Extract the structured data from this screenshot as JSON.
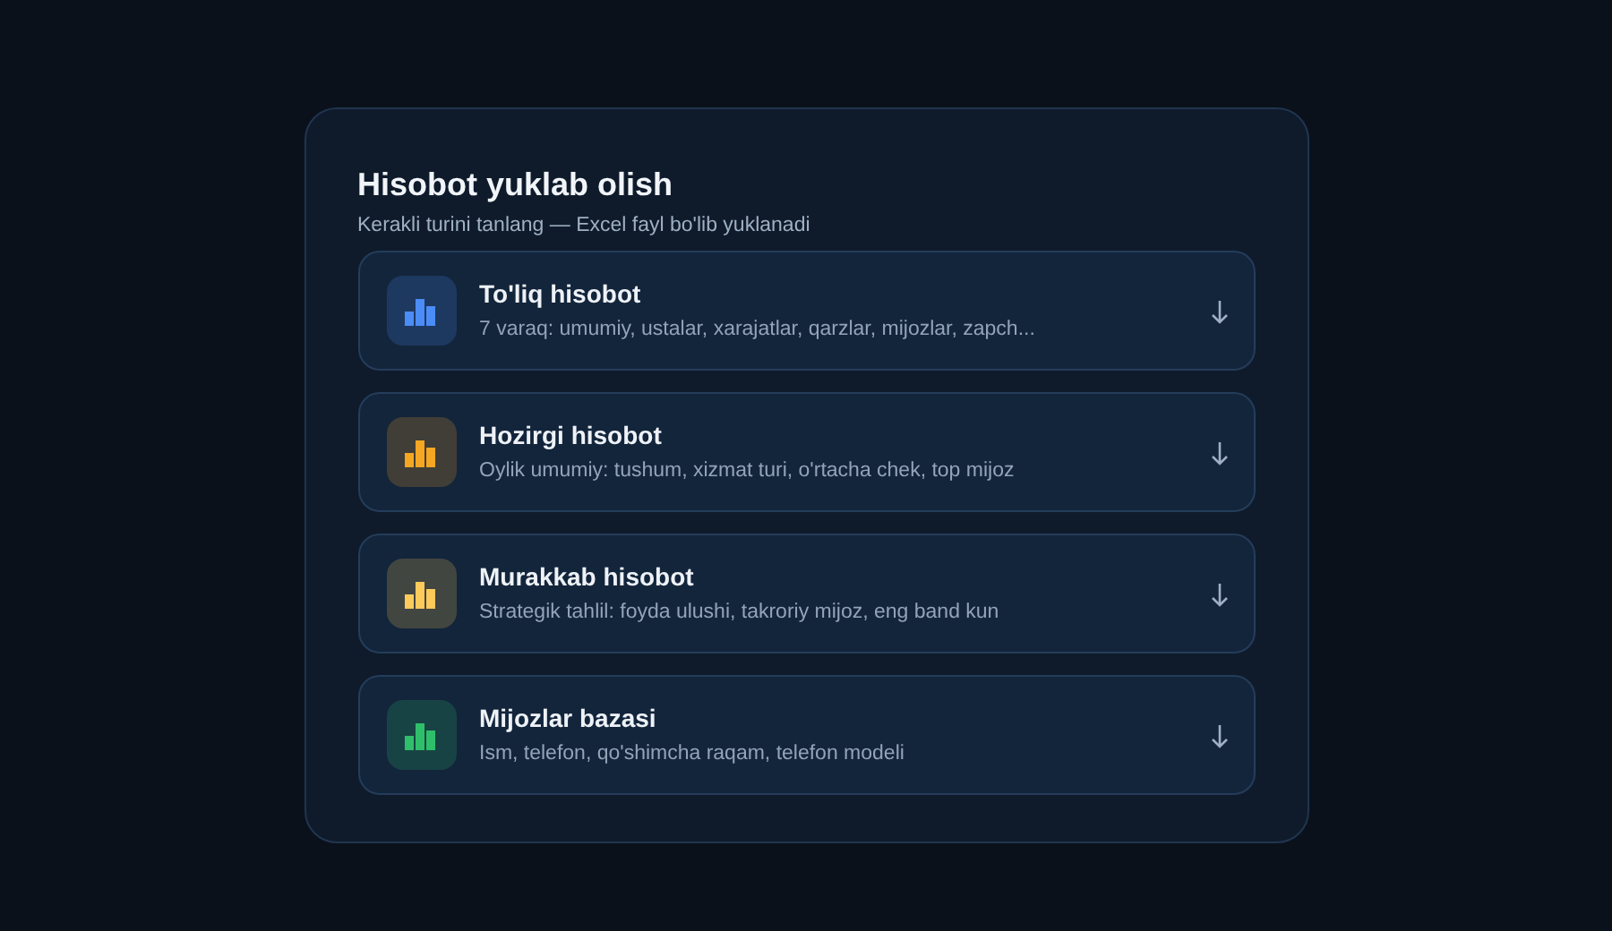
{
  "dialog": {
    "title": "Hisobot yuklab olish",
    "subtitle": "Kerakli turini tanlang — Excel fayl bo'lib yuklanadi",
    "options": [
      {
        "title": "To'liq hisobot",
        "description": "7 varaq: umumiy, ustalar, xarajatlar, qarzlar, mijozlar, zapch...",
        "color": "#4b8cf7"
      },
      {
        "title": "Hozirgi hisobot",
        "description": "Oylik umumiy: tushum, xizmat turi, o'rtacha chek, top mijoz",
        "color": "#f5a623"
      },
      {
        "title": "Murakkab hisobot",
        "description": "Strategik tahlil: foyda ulushi, takroriy mijoz, eng band kun",
        "color": "#fdcb5c"
      },
      {
        "title": "Mijozlar bazasi",
        "description": "Ism, telefon, qo'shimcha raqam, telefon modeli",
        "color": "#2fbf6b"
      }
    ]
  }
}
